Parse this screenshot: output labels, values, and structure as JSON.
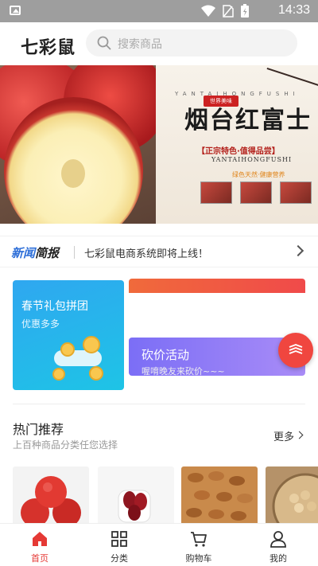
{
  "status_bar": {
    "time": "14:33"
  },
  "header": {
    "brand": "七彩鼠",
    "search_placeholder": "搜索商品"
  },
  "banner": {
    "pinyin_top": "YANTAIHONGFUSHI",
    "title": "烟台红富士",
    "stamp": "世界美味",
    "subtitle": "【正宗特色·值得品尝】",
    "pinyin": "YANTAIHONGFUSHI",
    "tagline": "绿色天然·健康营养"
  },
  "news": {
    "logo_blue": "新闻",
    "logo_dark": "简报",
    "text": "七彩鼠电商系统即将上线！"
  },
  "promo": {
    "group_title": "春节礼包拼团",
    "group_sub": "优惠多多",
    "bargain_title": "砍价活动",
    "bargain_sub": "喔唷晚友来砍价~~~"
  },
  "hot": {
    "title": "热门推荐",
    "subtitle": "上百种商品分类任您选择",
    "more": "更多"
  },
  "tabs": [
    {
      "label": "首页",
      "icon": "home-icon",
      "active": true
    },
    {
      "label": "分类",
      "icon": "grid-icon",
      "active": false
    },
    {
      "label": "购物车",
      "icon": "cart-icon",
      "active": false
    },
    {
      "label": "我的",
      "icon": "user-icon",
      "active": false
    }
  ],
  "colors": {
    "accent": "#e53935",
    "blue": "#2e6fd8"
  }
}
